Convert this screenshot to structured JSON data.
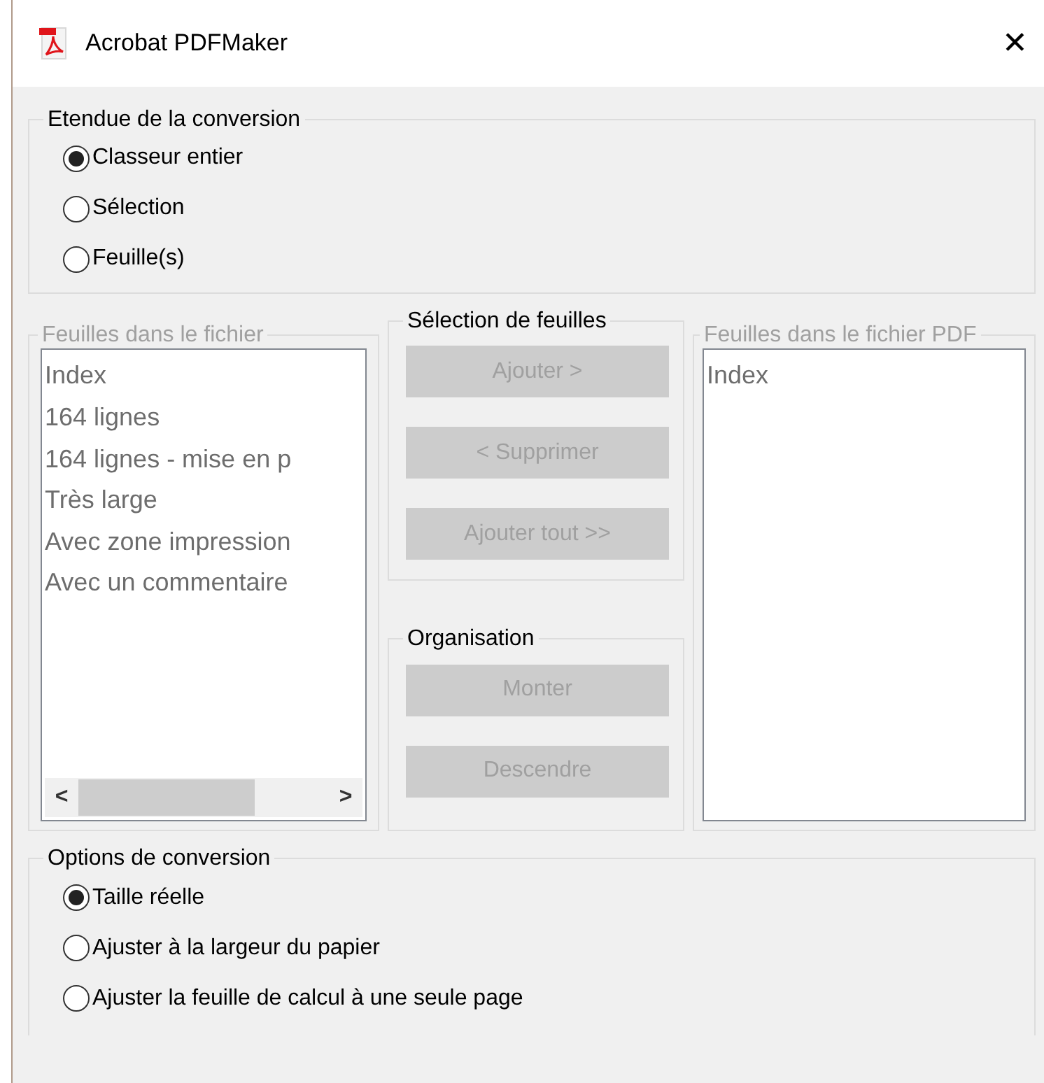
{
  "window": {
    "title": "Acrobat PDFMaker",
    "close": "✕"
  },
  "conversion_scope": {
    "label": "Etendue de la conversion",
    "options": [
      {
        "label": "Classeur entier",
        "selected": true
      },
      {
        "label": "Sélection",
        "selected": false
      },
      {
        "label": "Feuille(s)",
        "selected": false
      }
    ]
  },
  "sheets_in_file": {
    "label": "Feuilles dans le fichier",
    "disabled": true,
    "items": [
      "Index",
      "164 lignes",
      "164 lignes - mise en p",
      "Très large",
      "Avec zone impression",
      "Avec un commentaire"
    ],
    "scroll_left": "<",
    "scroll_right": ">"
  },
  "sheet_selection": {
    "label": "Sélection de feuilles",
    "buttons": [
      {
        "label": "Ajouter >",
        "disabled": true
      },
      {
        "label": "< Supprimer",
        "disabled": true
      },
      {
        "label": "Ajouter tout >>",
        "disabled": true
      }
    ]
  },
  "organisation": {
    "label": "Organisation",
    "buttons": [
      {
        "label": "Monter",
        "disabled": true
      },
      {
        "label": "Descendre",
        "disabled": true
      }
    ]
  },
  "sheets_in_pdf": {
    "label": "Feuilles dans le fichier PDF",
    "disabled": true,
    "items": [
      "Index"
    ]
  },
  "conversion_options": {
    "label": "Options de conversion",
    "options": [
      {
        "label": "Taille réelle",
        "selected": true
      },
      {
        "label": "Ajuster à la largeur du papier",
        "selected": false
      },
      {
        "label": "Ajuster la feuille de calcul à une seule page",
        "selected": false
      }
    ]
  }
}
